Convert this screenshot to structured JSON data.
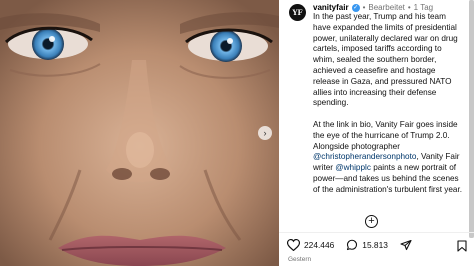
{
  "post": {
    "avatar_text": "YF",
    "username": "vanityfair",
    "verified_icon": "✓",
    "separator": "•",
    "edited": "Bearbeitet",
    "age": "1 Tag",
    "caption": {
      "paragraph_1": "In the past year, Trump and his team have expanded the limits of presidential power, unilaterally declared war on drug cartels, imposed tariffs according to whim, sealed the southern border, achieved a ceasefire and hostage release in Gaza, and pressured NATO allies into increasing their defense spending.",
      "p2_before_mention_1": "At the link in bio, Vanity Fair goes inside the eye of the hurricane of Trump 2.0. Alongside photographer ",
      "mention_1": "@christopherandersonphoto",
      "p2_between_mentions": ", Vanity Fair writer ",
      "mention_2": "@whipplc",
      "p2_after_mention_2": " paints a new portrait of power—and takes us behind the scenes of the administration's turbulent first year."
    },
    "add_comment_icon": "+",
    "carousel_next_icon": "›"
  },
  "actions": {
    "like_count": "224.446",
    "comment_count": "15.813"
  },
  "timestamp": "Gestern",
  "icons": {
    "like": "heart-icon",
    "comment": "comment-icon",
    "share": "share-icon",
    "save": "bookmark-icon"
  }
}
